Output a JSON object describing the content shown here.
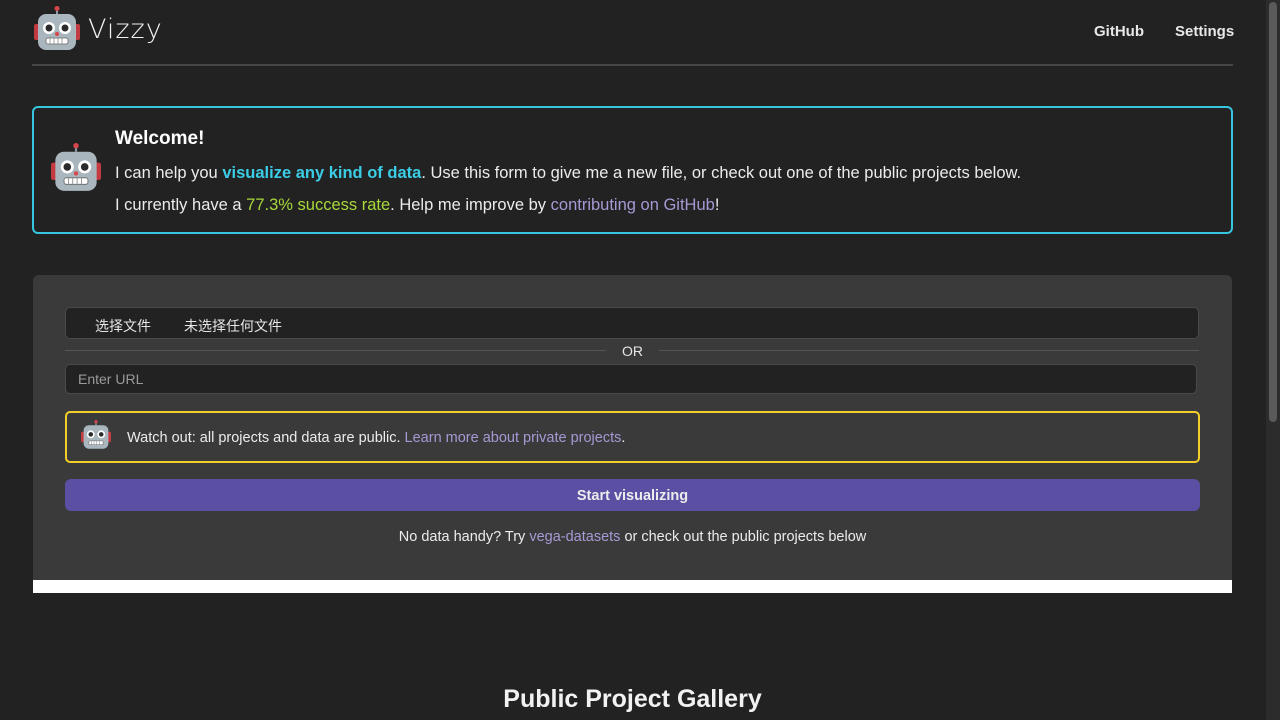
{
  "header": {
    "brand": "Vizzy",
    "nav": [
      "GitHub",
      "Settings"
    ]
  },
  "welcome": {
    "title": "Welcome!",
    "line1_prefix": "I can help you ",
    "line1_highlight": "visualize any kind of data",
    "line1_suffix": ". Use this form to give me a new file, or check out one of the public projects below.",
    "line2_prefix": "I currently have a ",
    "success_rate": "77.3% success rate",
    "line2_middle": ". Help me improve by ",
    "contribute_link": "contributing on GitHub",
    "line2_suffix": "!"
  },
  "form": {
    "file_button": "选择文件",
    "file_status": "未选择任何文件",
    "or_label": "OR",
    "url_placeholder": "Enter URL",
    "warning_text": "Watch out: all projects and data are public. ",
    "warning_link": "Learn more about private projects",
    "warning_suffix": ".",
    "start_button": "Start visualizing",
    "nodata_prefix": "No data handy? Try ",
    "nodata_link": "vega-datasets",
    "nodata_suffix": " or check out the public projects below"
  },
  "gallery": {
    "title": "Public Project Gallery"
  },
  "colors": {
    "accent_blue": "#36c6e0",
    "success_green": "#a8d83a",
    "link_purple": "#a799d4",
    "warning_yellow": "#f2cf2a",
    "button_purple": "#5b4fa3"
  },
  "icons": {
    "logo": "robot-icon",
    "welcome": "robot-icon",
    "warning": "robot-icon"
  }
}
